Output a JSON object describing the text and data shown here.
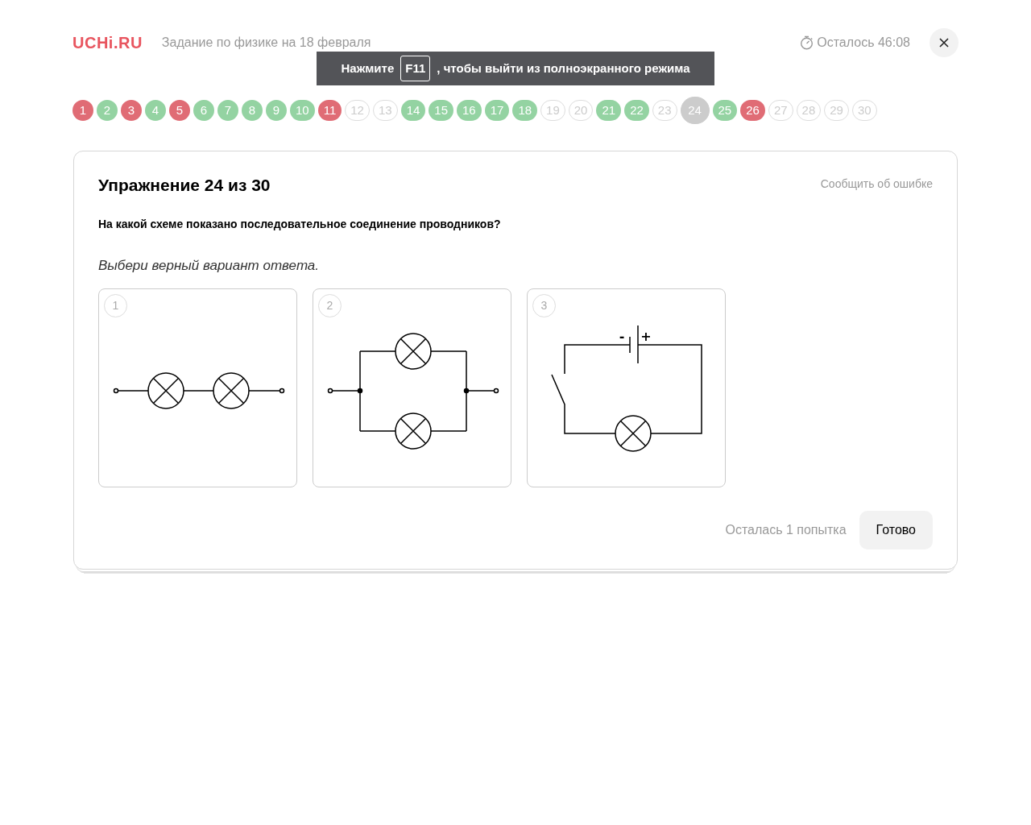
{
  "header": {
    "logo": "UCHi.RU",
    "title": "Задание по физике на 18 февраля",
    "timer": "Осталось 46:08"
  },
  "fullscreen_notice": {
    "before": "Нажмите",
    "key": "F11",
    "after": ", чтобы выйти из полноэкранного режима"
  },
  "tasks": [
    {
      "label": "1",
      "answered": true,
      "correct": false,
      "selected": false
    },
    {
      "label": "2",
      "answered": true,
      "correct": true,
      "selected": false
    },
    {
      "label": "3",
      "answered": true,
      "correct": false,
      "selected": false
    },
    {
      "label": "4",
      "answered": true,
      "correct": true,
      "selected": false
    },
    {
      "label": "5",
      "answered": true,
      "correct": false,
      "selected": false
    },
    {
      "label": "6",
      "answered": true,
      "correct": true,
      "selected": false
    },
    {
      "label": "7",
      "answered": true,
      "correct": true,
      "selected": false
    },
    {
      "label": "8",
      "answered": true,
      "correct": true,
      "selected": false
    },
    {
      "label": "9",
      "answered": true,
      "correct": true,
      "selected": false
    },
    {
      "label": "10",
      "answered": true,
      "correct": true,
      "selected": false
    },
    {
      "label": "11",
      "answered": true,
      "correct": false,
      "selected": false
    },
    {
      "label": "12",
      "answered": false,
      "selected": false
    },
    {
      "label": "13",
      "answered": false,
      "selected": false
    },
    {
      "label": "14",
      "answered": true,
      "correct": true,
      "selected": false
    },
    {
      "label": "15",
      "answered": true,
      "correct": true,
      "selected": false
    },
    {
      "label": "16",
      "answered": true,
      "correct": true,
      "selected": false
    },
    {
      "label": "17",
      "answered": true,
      "correct": true,
      "selected": false
    },
    {
      "label": "18",
      "answered": true,
      "correct": true,
      "selected": false
    },
    {
      "label": "19",
      "answered": false,
      "selected": false
    },
    {
      "label": "20",
      "answered": false,
      "selected": false
    },
    {
      "label": "21",
      "answered": true,
      "correct": true,
      "selected": false
    },
    {
      "label": "22",
      "answered": true,
      "correct": true,
      "selected": false
    },
    {
      "label": "23",
      "answered": false,
      "selected": false
    },
    {
      "label": "24",
      "answered": false,
      "selected": true
    },
    {
      "label": "25",
      "answered": true,
      "correct": true,
      "selected": false
    },
    {
      "label": "26",
      "answered": true,
      "correct": false,
      "selected": false
    },
    {
      "label": "27",
      "answered": false,
      "selected": false
    },
    {
      "label": "28",
      "answered": false,
      "selected": false
    },
    {
      "label": "29",
      "answered": false,
      "selected": false
    },
    {
      "label": "30",
      "answered": false,
      "selected": false
    }
  ],
  "exercise": {
    "title": "Упражнение 24 из 30",
    "report_link": "Сообщить об ошибке",
    "question": "На какой схеме показано последовательное соединение проводников?",
    "instruction": "Выбери верный вариант ответа.",
    "options": [
      {
        "number": "1",
        "kind": "series",
        "selected": false
      },
      {
        "number": "2",
        "kind": "parallel",
        "selected": false
      },
      {
        "number": "3",
        "kind": "switch",
        "selected": false,
        "battery_labels": [
          "-",
          "+"
        ]
      }
    ],
    "attempts": "Осталась 1 попытка",
    "submit": "Готово"
  }
}
